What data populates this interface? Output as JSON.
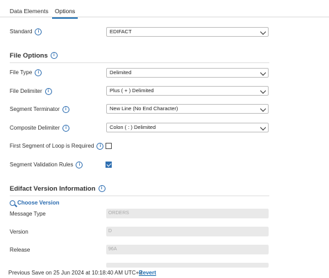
{
  "tabs": [
    "Data Elements",
    "Options"
  ],
  "standard": {
    "label": "Standard",
    "value": "EDIFACT"
  },
  "file_options": {
    "title": "File Options",
    "file_type": {
      "label": "File Type",
      "value": "Delimited"
    },
    "file_delimiter": {
      "label": "File Delimiter",
      "value": "Plus ( + ) Delimited"
    },
    "segment_terminator": {
      "label": "Segment Terminator",
      "value": "New Line (No End Character)"
    },
    "composite_delimiter": {
      "label": "Composite Delimiter",
      "value": "Colon ( : ) Delimited"
    },
    "first_segment_required": {
      "label": "First Segment of Loop is Required",
      "checked": false
    },
    "segment_validation": {
      "label": "Segment Validation Rules",
      "checked": true
    }
  },
  "version_info": {
    "title": "Edifact Version Information",
    "choose_label": "Choose Version",
    "message_type": {
      "label": "Message Type",
      "value": "ORDERS"
    },
    "version": {
      "label": "Version",
      "value": "D"
    },
    "release": {
      "label": "Release",
      "value": "96A"
    }
  },
  "footer": {
    "saved": "Previous Save on 25 Jun 2024 at 10:18:40 AM UTC+2",
    "revert": "Revert"
  }
}
